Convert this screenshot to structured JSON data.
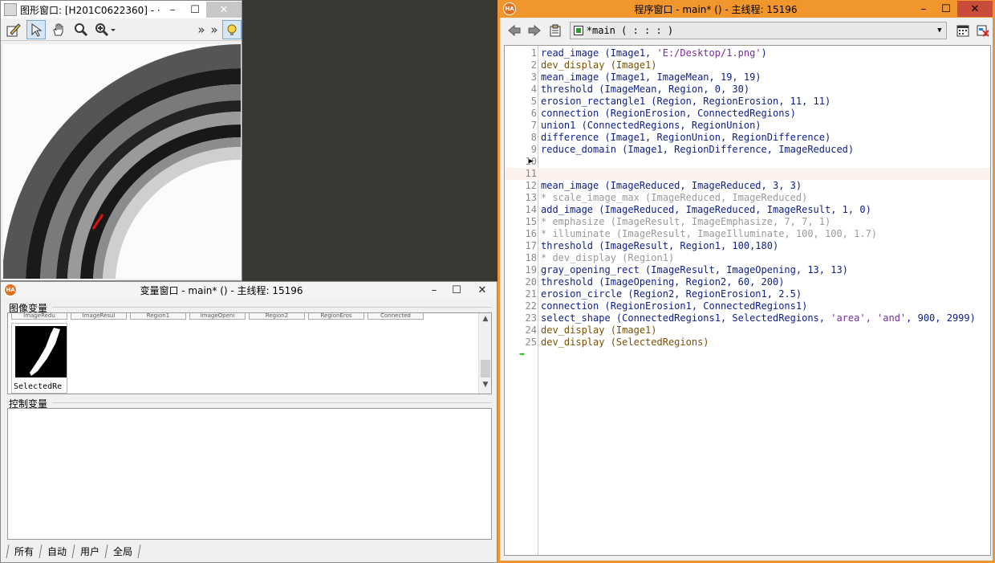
{
  "graphics_window": {
    "title": "图形窗口: [H201C0622360] - ···",
    "min_label": "–",
    "max_label": "☐",
    "close_label": "✕",
    "toolbar": {
      "more1": "»",
      "more2": "»"
    }
  },
  "variable_window": {
    "title": "变量窗口 - main* () - 主线程: 15196",
    "min_label": "–",
    "max_label": "☐",
    "close_label": "✕",
    "image_vars_label": "图像变量",
    "image_tabs": [
      "ImageRedu",
      "ImageResul",
      "Region1",
      "ImageOpeni",
      "Region2",
      "RegionEros",
      "Connected"
    ],
    "thumbnail_label": "SelectedRe",
    "control_vars_label": "控制变量",
    "bottom_tabs": [
      "所有",
      "自动",
      "用户",
      "全局"
    ]
  },
  "program_window": {
    "title": "程序窗口 - main* () - 主线程: 15196",
    "logo": "HA",
    "min_label": "–",
    "max_label": "☐",
    "close_label": "✕",
    "procedure": "*main ( : : : )",
    "lines": [
      {
        "n": "1",
        "op": "read_image",
        "args": " (Image1, ",
        "str": "'E:/Desktop/1.png'",
        "rest": ")",
        "cls": "op"
      },
      {
        "n": "2",
        "op": "dev_display",
        "args": " (Image1)",
        "str": "",
        "rest": "",
        "cls": "dd"
      },
      {
        "n": "3",
        "op": "mean_image",
        "args": " (Image1, ImageMean, 19, 19)",
        "str": "",
        "rest": "",
        "cls": "op"
      },
      {
        "n": "4",
        "op": "threshold",
        "args": " (ImageMean, Region, 0, 30)",
        "str": "",
        "rest": "",
        "cls": "op"
      },
      {
        "n": "5",
        "op": "erosion_rectangle1",
        "args": " (Region, RegionErosion, 11, 11)",
        "str": "",
        "rest": "",
        "cls": "op"
      },
      {
        "n": "6",
        "op": "connection",
        "args": " (RegionErosion, ConnectedRegions)",
        "str": "",
        "rest": "",
        "cls": "op"
      },
      {
        "n": "7",
        "op": "union1",
        "args": " (ConnectedRegions, RegionUnion)",
        "str": "",
        "rest": "",
        "cls": "op"
      },
      {
        "n": "8",
        "op": "difference",
        "args": " (Image1, RegionUnion, RegionDifference)",
        "str": "",
        "rest": "",
        "cls": "op"
      },
      {
        "n": "9",
        "op": "reduce_domain",
        "args": " (Image1, RegionDifference, ImageReduced)",
        "str": "",
        "rest": "",
        "cls": "op"
      },
      {
        "n": "10",
        "op": "",
        "args": "",
        "str": "",
        "rest": "",
        "cls": "op"
      },
      {
        "n": "11",
        "op": "",
        "args": "",
        "str": "",
        "rest": "",
        "cls": "op"
      },
      {
        "n": "12",
        "op": "mean_image",
        "args": " (ImageReduced, ImageReduced, 3, 3)",
        "str": "",
        "rest": "",
        "cls": "op"
      },
      {
        "n": "13",
        "op": "* scale_image_max (ImageReduced, ImageReduced)",
        "args": "",
        "str": "",
        "rest": "",
        "cls": "cm"
      },
      {
        "n": "14",
        "op": "add_image",
        "args": " (ImageReduced, ImageReduced, ImageResult, 1, 0)",
        "str": "",
        "rest": "",
        "cls": "op"
      },
      {
        "n": "15",
        "op": "* emphasize (ImageResult, ImageEmphasize, 7, 7, 1)",
        "args": "",
        "str": "",
        "rest": "",
        "cls": "cm"
      },
      {
        "n": "16",
        "op": "* illuminate (ImageResult, ImageIlluminate, 100, 100, 1.7)",
        "args": "",
        "str": "",
        "rest": "",
        "cls": "cm"
      },
      {
        "n": "17",
        "op": "threshold",
        "args": " (ImageResult, Region1, 100,180)",
        "str": "",
        "rest": "",
        "cls": "op"
      },
      {
        "n": "18",
        "op": "* dev_display (Region1)",
        "args": "",
        "str": "",
        "rest": "",
        "cls": "cm"
      },
      {
        "n": "19",
        "op": "gray_opening_rect",
        "args": " (ImageResult, ImageOpening, 13, 13)",
        "str": "",
        "rest": "",
        "cls": "op"
      },
      {
        "n": "20",
        "op": "threshold",
        "args": " (ImageOpening, Region2, 60, 200)",
        "str": "",
        "rest": "",
        "cls": "op"
      },
      {
        "n": "21",
        "op": "erosion_circle",
        "args": " (Region2, RegionErosion1, 2.5)",
        "str": "",
        "rest": "",
        "cls": "op"
      },
      {
        "n": "22",
        "op": "connection",
        "args": " (RegionErosion1, ConnectedRegions1)",
        "str": "",
        "rest": "",
        "cls": "op"
      },
      {
        "n": "23",
        "op": "select_shape",
        "args": " (ConnectedRegions1, SelectedRegions, ",
        "str": "'area', 'and'",
        "rest": ", 900, 2999)",
        "cls": "op"
      },
      {
        "n": "24",
        "op": "dev_display",
        "args": " (Image1)",
        "str": "",
        "rest": "",
        "cls": "dd"
      },
      {
        "n": "25",
        "op": "dev_display",
        "args": " (SelectedRegions)",
        "str": "",
        "rest": "",
        "cls": "dd"
      }
    ],
    "active_line": "11",
    "pc_arrow": "➡",
    "ip_marker": "▶"
  }
}
